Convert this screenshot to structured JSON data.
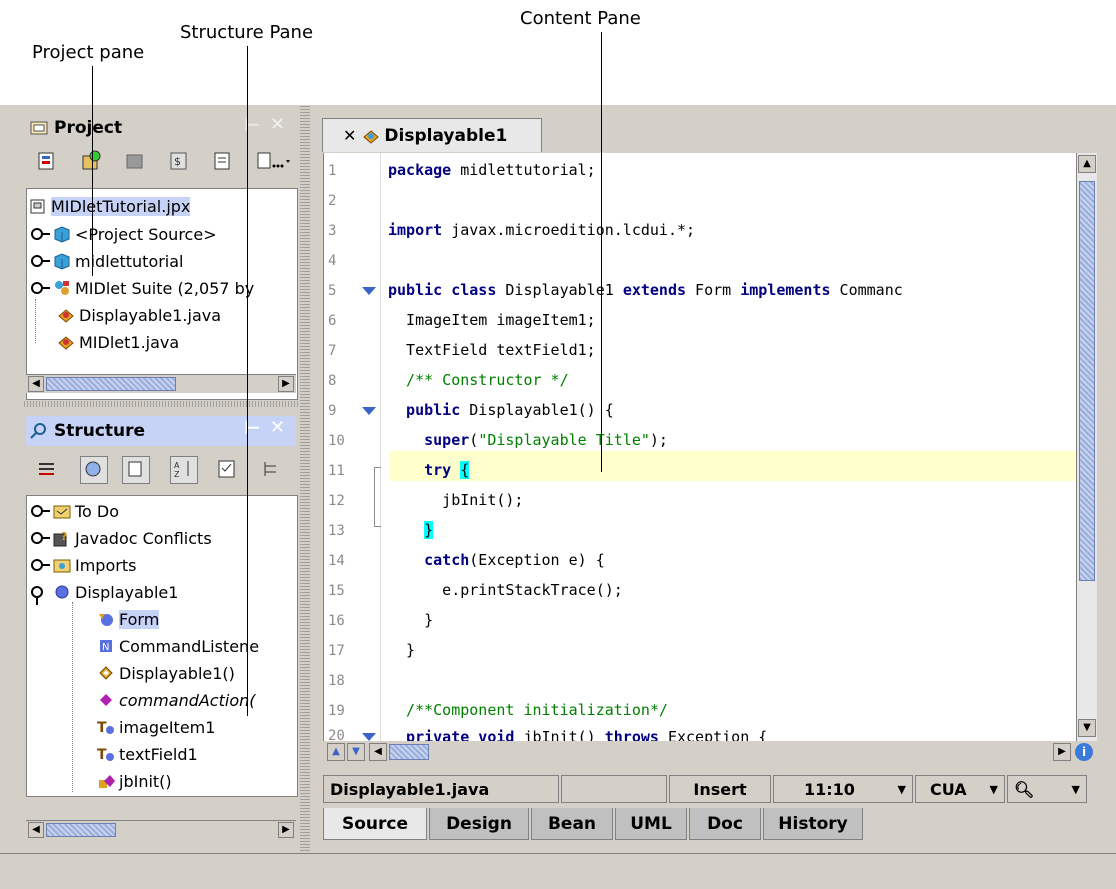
{
  "callouts": {
    "project_pane": "Project pane",
    "structure_pane": "Structure Pane",
    "content_pane": "Content Pane"
  },
  "project_panel": {
    "title": "Project",
    "close_icon": "✕",
    "tree": [
      {
        "label": "MIDletTutorial.jpx",
        "icon": "project-file-icon"
      },
      {
        "label": "<Project Source>",
        "icon": "package-icon"
      },
      {
        "label": "midlettutorial",
        "icon": "package-icon"
      },
      {
        "label": "MIDlet Suite (2,057 by",
        "icon": "midlet-suite-icon"
      },
      {
        "label": "Displayable1.java",
        "icon": "java-file-icon"
      },
      {
        "label": "MIDlet1.java",
        "icon": "java-file-icon"
      }
    ]
  },
  "structure_panel": {
    "title": "Structure",
    "tree": [
      {
        "label": "To Do",
        "icon": "folder-icon"
      },
      {
        "label": "Javadoc Conflicts",
        "icon": "javadoc-icon"
      },
      {
        "label": "Imports",
        "icon": "imports-icon"
      },
      {
        "label": "Displayable1",
        "icon": "class-icon"
      },
      {
        "label": "Form",
        "icon": "superclass-icon"
      },
      {
        "label": "CommandListene",
        "icon": "interface-icon"
      },
      {
        "label": "Displayable1()",
        "icon": "constructor-icon"
      },
      {
        "label": "commandAction(",
        "icon": "method-icon"
      },
      {
        "label": "imageItem1",
        "icon": "field-icon"
      },
      {
        "label": "textField1",
        "icon": "field-icon"
      },
      {
        "label": "jbInit()",
        "icon": "private-method-icon"
      }
    ]
  },
  "editor": {
    "tab_label": "Displayable1",
    "line_numbers": [
      "1",
      "2",
      "3",
      "4",
      "5",
      "6",
      "7",
      "8",
      "9",
      "10",
      "11",
      "12",
      "13",
      "14",
      "15",
      "16",
      "17",
      "18",
      "19",
      "20"
    ],
    "code": {
      "l1_kw": "package",
      "l1_rest": " midlettutorial;",
      "l3_kw": "import",
      "l3_rest": " javax.microedition.lcdui.*;",
      "l5_kw1": "public class",
      "l5_mid1": " Displayable1 ",
      "l5_kw2": "extends",
      "l5_mid2": " Form ",
      "l5_kw3": "implements",
      "l5_rest": " Commanc",
      "l6": "  ImageItem imageItem1;",
      "l7": "  TextField textField1;",
      "l8": "  /** Constructor */",
      "l9_kw": "  public",
      "l9_rest": " Displayable1() {",
      "l10_kw": "    super",
      "l10_p1": "(",
      "l10_str": "\"Displayable Title\"",
      "l10_p2": ");",
      "l11_kw": "    try",
      "l11_sp": " ",
      "l11_brace": "{",
      "l12": "      jbInit();",
      "l13_sp": "    ",
      "l13_brace": "}",
      "l14_kw": "    catch",
      "l14_rest": "(Exception e) {",
      "l15": "      e.printStackTrace();",
      "l16": "    }",
      "l17": "  }",
      "l19": "  /**Component initialization*/",
      "l20_kw1": "  private void",
      "l20_mid": " jbInit() ",
      "l20_kw2": "throws",
      "l20_rest": " Exception {"
    }
  },
  "status": {
    "file": "Displayable1.java",
    "mode": "Insert",
    "position": "11:10",
    "keymap": "CUA"
  },
  "bottom_tabs": [
    "Source",
    "Design",
    "Bean",
    "UML",
    "Doc",
    "History"
  ],
  "colors": {
    "keyword": "#000080",
    "string": "#008000",
    "comment": "#008000",
    "current_line": "#ffffcc",
    "brace_match": "#00ffff",
    "panel_title_bg": "#c6d3f7"
  }
}
